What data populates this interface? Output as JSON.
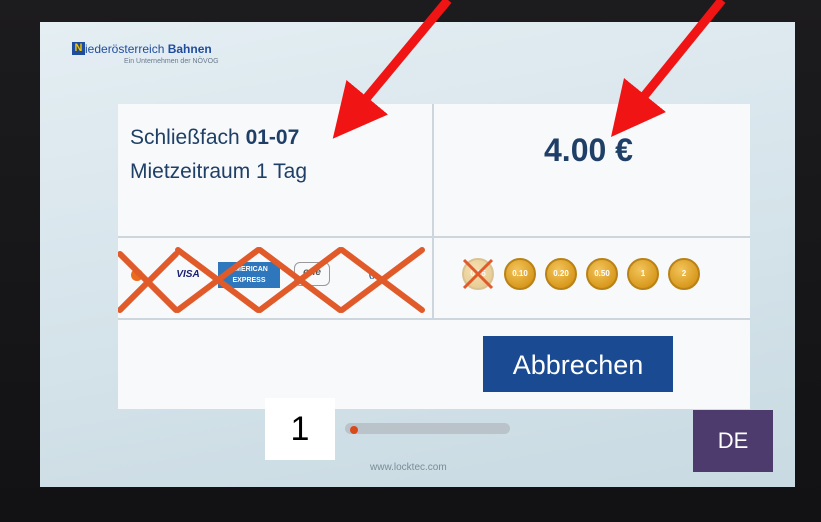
{
  "brand": {
    "logo_letter": "N",
    "name_prefix": "iederösterreich ",
    "name_bold": "Bahnen",
    "subline": "Ein Unternehmen der NÖVOG"
  },
  "locker": {
    "label": "Schließfach ",
    "number": "01-07",
    "period": "Mietzeitraum 1 Tag"
  },
  "price": "4.00 €",
  "payment_cards": [
    {
      "label": "VISA",
      "color": "#1a1f71",
      "disabled": true
    },
    {
      "label": "AMERICAN EXPRESS",
      "color": "#2e77bc",
      "disabled": true
    },
    {
      "label": "one",
      "color": "#555555",
      "disabled": true
    },
    {
      "label": "()",
      "color": "#3b6ea8",
      "disabled": true
    }
  ],
  "coins": [
    {
      "label": "0.05",
      "disabled": true
    },
    {
      "label": "0.10",
      "disabled": false
    },
    {
      "label": "0.20",
      "disabled": false
    },
    {
      "label": "0.50",
      "disabled": false
    },
    {
      "label": "1",
      "disabled": false
    },
    {
      "label": "2",
      "disabled": false
    }
  ],
  "cancel_button": "Abbrechen",
  "progress": 0.03,
  "footer_url": "www.locktec.com",
  "language_button": "DE",
  "marker_label": "1",
  "colors": {
    "accent_blue": "#1a4a92",
    "text_navy": "#1f3f67",
    "language_purple": "#4c3b6c",
    "annotation_red": "#f01414",
    "cross_red": "#e05a2a"
  }
}
